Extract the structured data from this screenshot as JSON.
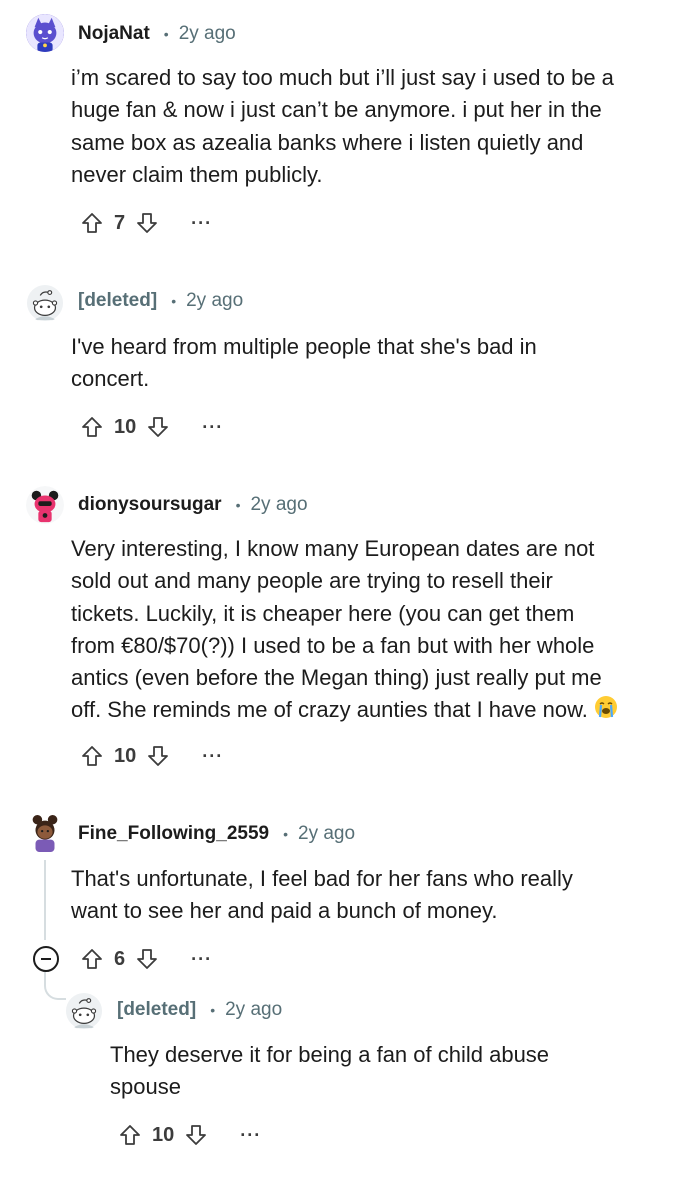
{
  "comments": [
    {
      "username": "NojaNat",
      "age": "2y ago",
      "lines": [
        "i’m scared to say too much but i’ll just say i used to be a",
        "huge fan & now i just can’t be anymore. i put her in the",
        "same box as azealia banks where i listen quietly and",
        "never claim them publicly."
      ],
      "score": "7",
      "avatar_icon": "cat-avatar-icon"
    },
    {
      "username": "[deleted]",
      "age": "2y ago",
      "lines": [
        "I've heard from multiple people that she's bad in",
        "concert."
      ],
      "score": "10",
      "avatar_icon": "deleted-snoo-avatar-icon"
    },
    {
      "username": "dionysoursugar",
      "age": "2y ago",
      "lines": [
        "Very interesting, I know many European dates are not",
        "sold out and many people are trying to resell their",
        "tickets. Luckily, it is cheaper here (you can get them",
        "from €80/$70(?)) I used to be a fan but with her whole",
        "antics (even before the Megan thing) just really put me",
        "off. She reminds me of crazy aunties that I have now."
      ],
      "emoji": "crying-face-icon",
      "score": "10",
      "avatar_icon": "pink-snoo-avatar-icon"
    },
    {
      "username": "Fine_Following_2559",
      "age": "2y ago",
      "lines": [
        "That's unfortunate, I feel bad for her fans who really",
        "want to see her and paid a bunch of money."
      ],
      "score": "6",
      "avatar_icon": "girl-avatar-icon"
    },
    {
      "username": "[deleted]",
      "age": "2y ago",
      "lines": [
        "They deserve it for being a fan of child abuse",
        "spouse"
      ],
      "score": "10",
      "avatar_icon": "deleted-snoo-avatar-icon"
    }
  ],
  "actions": {
    "more_label": "···"
  },
  "colors": {
    "meta_gray": "#576f76",
    "text": "#1c1c1c",
    "thread_line": "#d6dde0"
  }
}
